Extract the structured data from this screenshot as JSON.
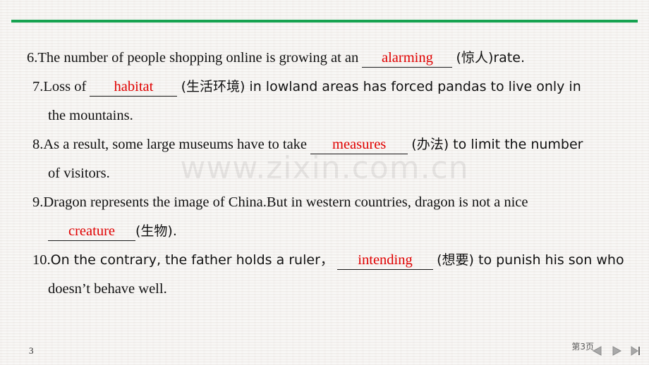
{
  "slide": {
    "accent_color": "#16a250",
    "background_color": "#f3f1ef",
    "answer_color": "#e00000",
    "text_color": "#111111",
    "watermark": "www.zixin.com.cn",
    "page_number": "3",
    "page_label": "第3页"
  },
  "questions": [
    {
      "number": "6.",
      "before": "The number of people shopping online is growing at an",
      "answer": "alarming",
      "after": "(惊人)rate."
    },
    {
      "number": "7.",
      "before": "Loss of",
      "answer": "habitat",
      "after": "(生活环境) in lowland areas has forced pandas to live only in",
      "continuation": "the mountains."
    },
    {
      "number": "8.",
      "before": "As a result, some large museums have to take",
      "answer": "measures",
      "after": "(办法) to limit the number",
      "continuation": "of visitors."
    },
    {
      "number": "9.",
      "before": "Dragon represents the image of China.But in western countries, dragon is not a nice",
      "answer": "creature",
      "after": "(生物)."
    },
    {
      "number": "10.",
      "before": "On the contrary, the father holds a ruler，",
      "answer": "intending",
      "after": "(想要) to punish his son who",
      "continuation": "doesn’t behave well."
    }
  ],
  "nav": {
    "previous": "previous-slide",
    "play": "next-slide",
    "last": "last-slide"
  }
}
